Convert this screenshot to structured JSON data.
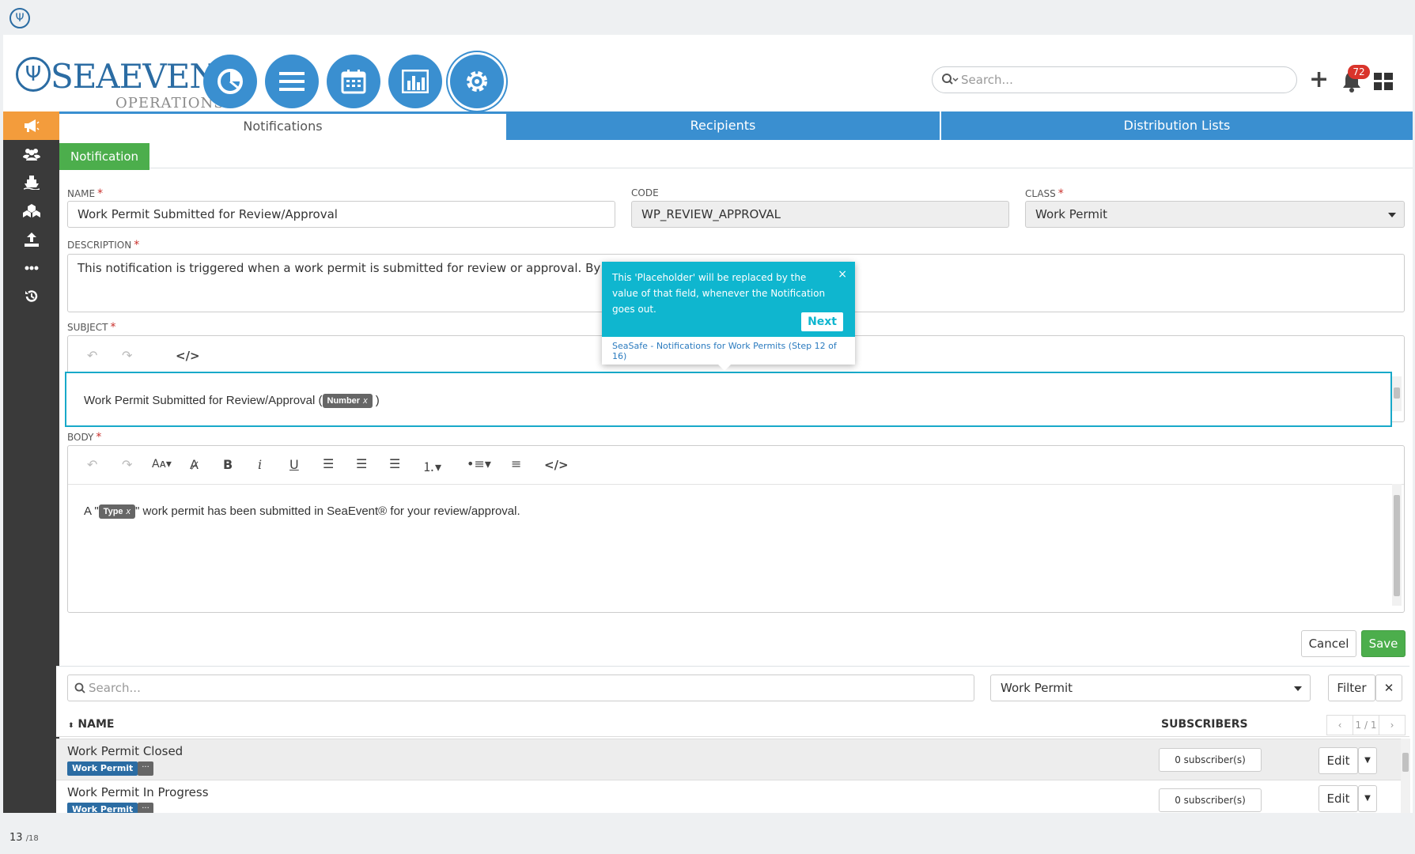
{
  "header": {
    "brand_name": "SEAEVENT",
    "brand_sub": "OPERATIONS",
    "search_placeholder": "Search...",
    "notification_count": "72"
  },
  "tabs": [
    {
      "label": "Notifications",
      "active": true
    },
    {
      "label": "Recipients",
      "active": false
    },
    {
      "label": "Distribution Lists",
      "active": false
    }
  ],
  "subtab": {
    "label": "Notification"
  },
  "form": {
    "name_label": "NAME",
    "name_value": "Work Permit Submitted for Review/Approval",
    "code_label": "CODE",
    "code_value": "WP_REVIEW_APPROVAL",
    "class_label": "CLASS",
    "class_value": "Work Permit",
    "description_label": "DESCRIPTION",
    "description_value": "This notification is triggered when a work permit is submitted for review or approval. By default it is s",
    "subject_label": "SUBJECT",
    "subject_text_before": "Work Permit Submitted for Review/Approval (",
    "subject_chip": "Number",
    "subject_text_after": ")",
    "body_label": "BODY",
    "body_text_before": "A \"",
    "body_chip": "Type",
    "body_text_after": "\" work permit has been submitted in SeaEvent® for your review/approval.",
    "chip_remove": "x"
  },
  "actions": {
    "cancel_label": "Cancel",
    "save_label": "Save"
  },
  "tooltip": {
    "text": "This 'Placeholder' will be replaced by the value of that field, whenever the Notification goes out.",
    "next_label": "Next",
    "footer": "SeaSafe - Notifications for Work Permits (Step 12 of 16)"
  },
  "list": {
    "search_placeholder": "Search...",
    "filter_select": "Work Permit",
    "filter_label": "Filter",
    "col_name": "NAME",
    "col_subscribers": "SUBSCRIBERS",
    "pager": "1 / 1",
    "rows": [
      {
        "name": "Work Permit Closed",
        "tag": "Work Permit",
        "subscribers": "0 subscriber(s)",
        "edit": "Edit"
      },
      {
        "name": "Work Permit In Progress",
        "tag": "Work Permit",
        "subscribers": "0 subscriber(s)",
        "edit": "Edit"
      }
    ]
  },
  "footer": {
    "page": "13",
    "total": "/18"
  },
  "colors": {
    "primary": "#3a8fd0",
    "sidebar": "#3a3a3a",
    "sidebar_active": "#f39c3c",
    "green": "#4cae4c",
    "tooltip": "#0fb6cf"
  },
  "icons": [
    "trident-icon",
    "pie-chart-icon",
    "list-icon",
    "calendar-icon",
    "bar-chart-icon",
    "gear-icon",
    "search-icon",
    "plus-icon",
    "bell-icon",
    "grid-icon",
    "megaphone-icon",
    "users-icon",
    "ship-icon",
    "cubes-icon",
    "upload-icon",
    "more-icon",
    "history-icon",
    "undo-icon",
    "redo-icon",
    "code-icon"
  ]
}
